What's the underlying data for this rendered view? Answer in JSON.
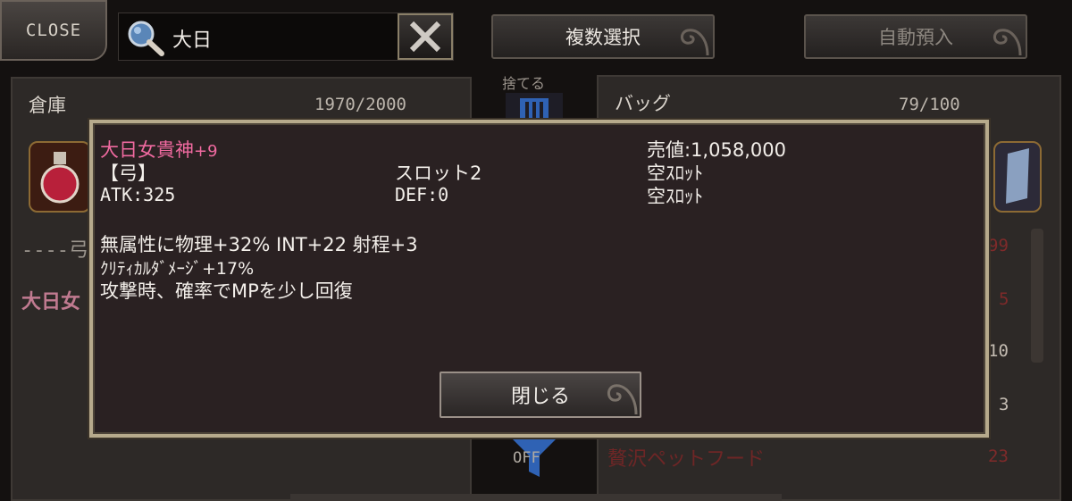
{
  "top_bar": {
    "close_label": "CLOSE",
    "search_value": "大日",
    "multi_select_label": "複数選択",
    "auto_deposit_label": "自動預入"
  },
  "warehouse": {
    "title": "倉庫",
    "count": "1970/2000",
    "bg_item_partial_1": "----弓",
    "bg_item_partial_2": "大日女"
  },
  "middle": {
    "discard_label": "捨てる",
    "filter_label": "OFF"
  },
  "bag": {
    "title": "バッグ",
    "count": "79/100",
    "bg_counts": [
      "99",
      "5",
      "10",
      "3",
      "23"
    ],
    "bg_item_name": "贅沢ペットフード"
  },
  "dialog": {
    "item_name": "大日女貴神",
    "enhance": "+9",
    "type": "【弓】",
    "atk": "ATK:325",
    "slot_label": "スロット2",
    "def": "DEF:0",
    "sell_value": "売値:1,058,000",
    "slot1": "空ｽﾛｯﾄ",
    "slot2": "空ｽﾛｯﾄ",
    "effect1": "無属性に物理+32% INT+22 射程+3",
    "effect2": "ｸﾘﾃｨｶﾙﾀﾞﾒｰｼﾞ+17%",
    "effect3": "攻撃時、確率でMPを少し回復",
    "close_button": "閉じる"
  },
  "colors": {
    "item_name_pink": "#f06aa0",
    "dialog_border": "#b7aa8c",
    "bg_count_red": "#7e2a2a"
  }
}
